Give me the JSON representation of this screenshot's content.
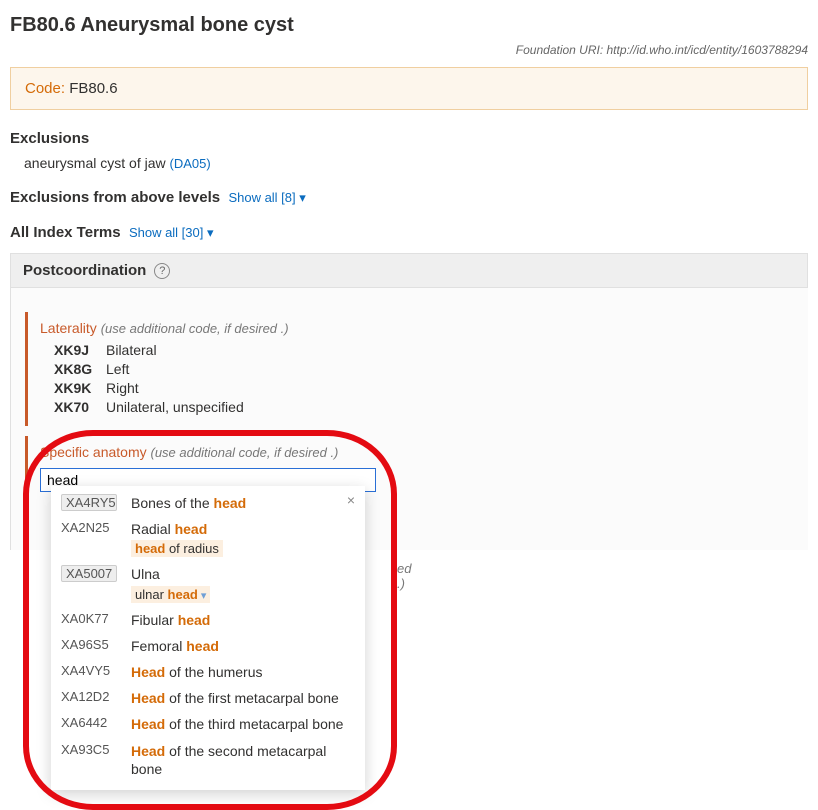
{
  "title": "FB80.6 Aneurysmal bone cyst",
  "foundation_uri": "Foundation URI: http://id.who.int/icd/entity/1603788294",
  "code_label": "Code:",
  "code_value": "FB80.6",
  "exclusions_heading": "Exclusions",
  "exclusion_text": "aneurysmal cyst of jaw",
  "exclusion_ref": "(DA05)",
  "exclusions_above_heading": "Exclusions from above levels",
  "exclusions_above_link": "Show all [8] ▾",
  "index_terms_heading": "All Index Terms",
  "index_terms_link": "Show all [30] ▾",
  "postcoord_heading": "Postcoordination",
  "help_symbol": "?",
  "axis_laterality": {
    "name": "Laterality",
    "hint": "(use additional code, if desired .)",
    "items": [
      {
        "code": "XK9J",
        "label": "Bilateral"
      },
      {
        "code": "XK8G",
        "label": "Left"
      },
      {
        "code": "XK9K",
        "label": "Right"
      },
      {
        "code": "XK70",
        "label": "Unilateral, unspecified"
      }
    ]
  },
  "axis_anatomy": {
    "name": "Specific anatomy",
    "hint": "(use additional code, if desired .)",
    "search_value": "head"
  },
  "peek_hint": "ed .)",
  "dropdown": {
    "close": "×",
    "items": [
      {
        "code": "XA4RY5",
        "boxed": true,
        "pre": "Bones of the ",
        "hl": "head",
        "post": "",
        "sub_pre": "",
        "sub_hl": "",
        "sub_post": ""
      },
      {
        "code": "XA2N25",
        "boxed": false,
        "pre": "Radial ",
        "hl": "head",
        "post": "",
        "sub_pre": "",
        "sub_hl": "head",
        "sub_post": " of radius"
      },
      {
        "code": "XA5007",
        "boxed": true,
        "pre": "Ulna",
        "hl": "",
        "post": "",
        "sub_pre": "ulnar ",
        "sub_hl": "head",
        "sub_post": " ▾"
      },
      {
        "code": "XA0K77",
        "boxed": false,
        "pre": "Fibular ",
        "hl": "head",
        "post": ""
      },
      {
        "code": "XA96S5",
        "boxed": false,
        "pre": "Femoral ",
        "hl": "head",
        "post": ""
      },
      {
        "code": "XA4VY5",
        "boxed": false,
        "pre": "",
        "hl": "Head",
        "post": " of the humerus"
      },
      {
        "code": "XA12D2",
        "boxed": false,
        "pre": "",
        "hl": "Head",
        "post": " of the first metacarpal bone"
      },
      {
        "code": "XA6442",
        "boxed": false,
        "pre": "",
        "hl": "Head",
        "post": " of the third metacarpal bone"
      },
      {
        "code": "XA93C5",
        "boxed": false,
        "pre": "",
        "hl": "Head",
        "post": " of the second metacarpal bone"
      }
    ]
  }
}
